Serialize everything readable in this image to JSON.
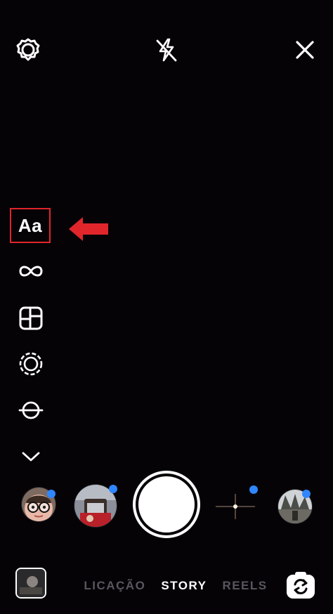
{
  "top_bar": {
    "settings_icon": "gear-icon",
    "flash_icon": "flash-off-icon",
    "close_icon": "close-icon"
  },
  "side_tools": {
    "create_label": "Aa",
    "tools": [
      "text-tool",
      "boomerang-icon",
      "layout-icon",
      "focus-icon",
      "level-icon",
      "chevron-down-icon"
    ]
  },
  "annotation": {
    "highlight_color": "#e0262b"
  },
  "effects_bar": {
    "items": [
      "glasses-face-effect",
      "coffee-effect",
      "shutter",
      "sparkle-effect",
      "photo-effect"
    ],
    "new_dot_color": "#2f86ff"
  },
  "modes": {
    "left": "LICAÇÃO",
    "active": "STORY",
    "right": "REELS"
  }
}
